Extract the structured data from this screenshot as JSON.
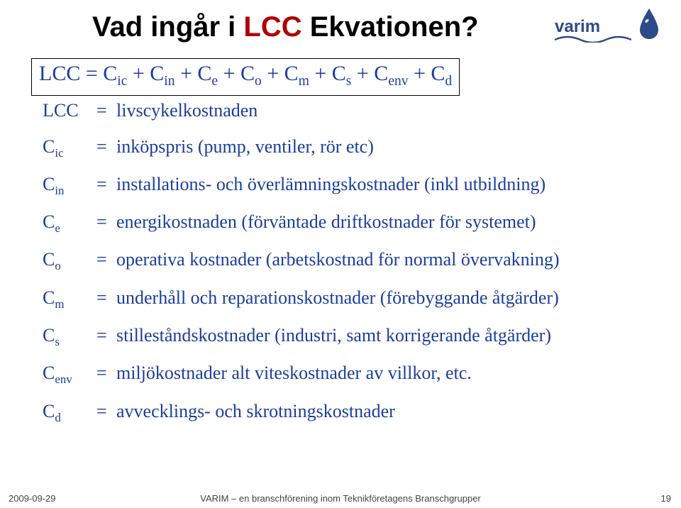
{
  "title": {
    "part1": "Vad ingår i ",
    "part2": "LCC",
    "part3": " Ekvationen?"
  },
  "equation_html": "LCC = C<sub>ic</sub> + C<sub>in</sub> + C<sub>e</sub> + C<sub>o</sub> + C<sub>m</sub> + C<sub>s</sub> + C<sub>env</sub> + C<sub>d</sub>",
  "definitions": [
    {
      "sym_html": "LCC",
      "txt": "livscykelkostnaden"
    },
    {
      "sym_html": "C<sub>ic</sub>",
      "txt": "inköpspris (pump, ventiler, rör etc)"
    },
    {
      "sym_html": "C<sub>in</sub>",
      "txt": "installations- och överlämningskostnader (inkl utbildning)"
    },
    {
      "sym_html": "C<sub>e</sub>",
      "txt": "energikostnaden (förväntade driftkostnader för systemet)"
    },
    {
      "sym_html": "C<sub>o</sub>",
      "txt": "operativa kostnader (arbetskostnad för normal övervakning)"
    },
    {
      "sym_html": "C<sub>m</sub>",
      "txt": "underhåll och reparationskostnader (förebyggande åtgärder)"
    },
    {
      "sym_html": "C<sub>s</sub>",
      "txt": "stilleståndskostnader (industri, samt korrigerande åtgärder)"
    },
    {
      "sym_html": "C<sub>env</sub>",
      "txt": "miljökostnader alt viteskostnader av villkor, etc."
    },
    {
      "sym_html": "C<sub>d</sub>",
      "txt": "avvecklings- och skrotningskostnader"
    }
  ],
  "eq_symbol": "=",
  "logo": {
    "text": "varim"
  },
  "footer": {
    "date": "2009-09-29",
    "center": "VARIM – en branschförening inom Teknikföretagens Branschgrupper",
    "page": "19"
  }
}
